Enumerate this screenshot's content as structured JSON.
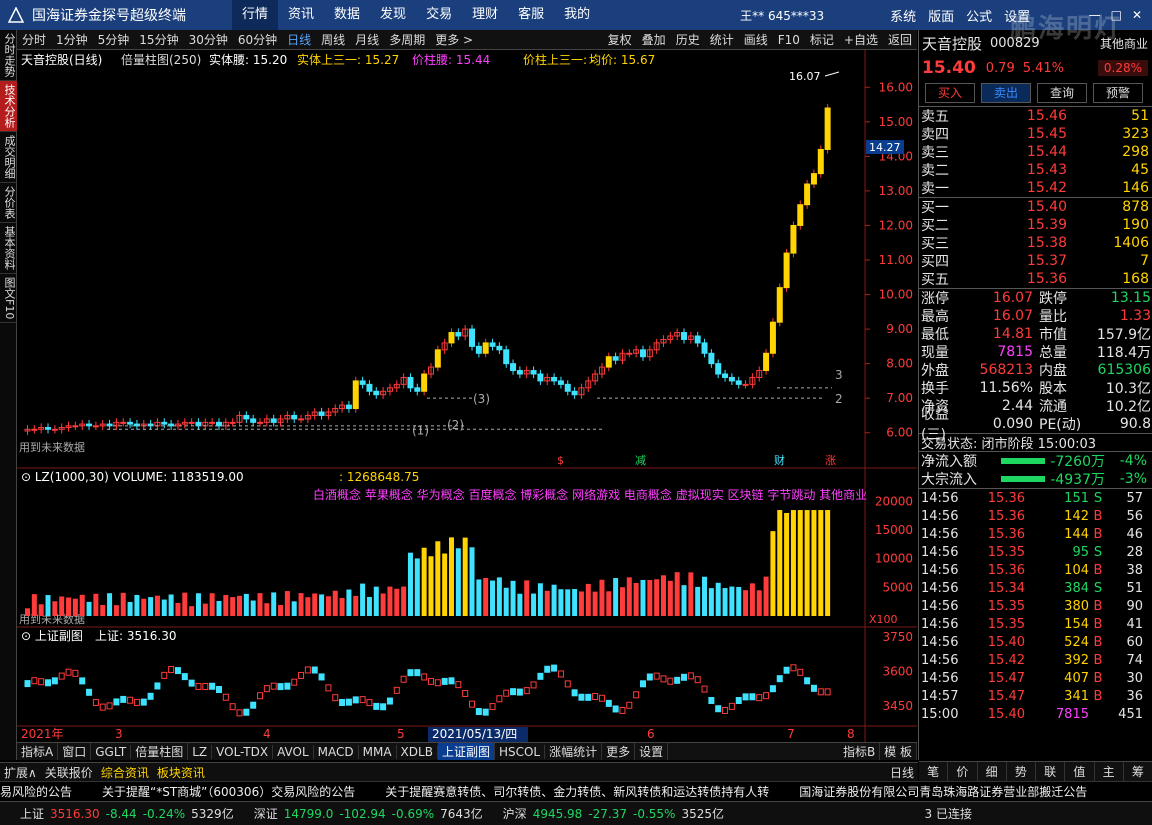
{
  "app": {
    "title": "国海证券金探号超级终端"
  },
  "menu": [
    "行情",
    "资讯",
    "数据",
    "发现",
    "交易",
    "理财",
    "客服",
    "我的"
  ],
  "user": "王**  645***33",
  "sys_menu": [
    "系统",
    "版面",
    "公式",
    "设置"
  ],
  "left_tabs": [
    "分时走势",
    "技术分析",
    "成交明细",
    "分价表",
    "基本资料",
    "图文F10"
  ],
  "toolbar": {
    "periods": [
      "分时",
      "1分钟",
      "5分钟",
      "15分钟",
      "30分钟",
      "60分钟",
      "日线",
      "周线",
      "月线",
      "多周期",
      "更多 >"
    ],
    "tools": [
      "复权",
      "叠加",
      "历史",
      "统计",
      "画线",
      "F10",
      "标记",
      "+自选",
      "返回"
    ]
  },
  "chart_data": {
    "type": "candlestick",
    "title": "天音控股(日线)",
    "indicator_line": {
      "label1": "倍量柱图(250)",
      "v1": "实体腰: 15.20",
      "v2": "实体上三一: 15.27",
      "v3": "价柱腰: 15.44",
      "v4": "价柱上三一: -",
      "v5": "均价: 15.67"
    },
    "y_ticks": [
      "16.00",
      "15.00",
      "14.00",
      "13.00",
      "12.00",
      "11.00",
      "10.00",
      "9.00",
      "8.00",
      "7.00",
      "6.00"
    ],
    "ylim": [
      5.5,
      16.5
    ],
    "marker_high": "16.07",
    "current_marker": "14.27",
    "closes": [
      6.1,
      6.1,
      6.15,
      6.1,
      6.1,
      6.15,
      6.2,
      6.2,
      6.25,
      6.2,
      6.2,
      6.25,
      6.2,
      6.3,
      6.3,
      6.25,
      6.2,
      6.25,
      6.2,
      6.3,
      6.25,
      6.2,
      6.25,
      6.3,
      6.3,
      6.2,
      6.3,
      6.3,
      6.2,
      6.3,
      6.3,
      6.5,
      6.4,
      6.3,
      6.3,
      6.4,
      6.3,
      6.4,
      6.5,
      6.4,
      6.4,
      6.5,
      6.6,
      6.5,
      6.6,
      6.7,
      6.8,
      6.7,
      7.5,
      7.4,
      7.2,
      7.1,
      7.2,
      7.3,
      7.4,
      7.6,
      7.3,
      7.2,
      7.7,
      7.9,
      8.4,
      8.6,
      8.9,
      8.8,
      9.0,
      8.5,
      8.3,
      8.6,
      8.5,
      8.4,
      8.0,
      7.8,
      7.7,
      7.8,
      7.7,
      7.5,
      7.6,
      7.5,
      7.4,
      7.2,
      7.1,
      7.3,
      7.5,
      7.7,
      7.9,
      8.2,
      8.1,
      8.3,
      8.3,
      8.4,
      8.2,
      8.4,
      8.6,
      8.7,
      8.8,
      8.9,
      8.7,
      8.8,
      8.6,
      8.3,
      8.0,
      7.7,
      7.6,
      7.5,
      7.4,
      7.4,
      7.6,
      7.8,
      8.3,
      9.2,
      10.2,
      11.2,
      12.0,
      12.6,
      13.2,
      13.5,
      14.2,
      15.4
    ],
    "sub_labels": {
      "left": "用到未来数据",
      "events": [
        "$",
        "减",
        "财",
        "涨"
      ]
    },
    "volume": {
      "label": "LZ(1000,30)",
      "value": "VOLUME: 1183519.00",
      "extra": ": 1268648.75",
      "y_ticks": [
        "20000",
        "15000",
        "10000",
        "5000"
      ],
      "scale": "X100",
      "concepts": "白酒概念 苹果概念 华为概念 百度概念 博彩概念 网络游戏 电商概念 虚拟现实 区块链 字节跳动  其他商业"
    },
    "index": {
      "label": "上证副图",
      "value": "上证: 3516.30",
      "y_ticks": [
        "3750",
        "3600",
        "3450"
      ]
    },
    "x_ticks": [
      "2021年",
      "3",
      "4",
      "5",
      "2021/05/13/四",
      "6",
      "7",
      "8"
    ]
  },
  "indicator_tabs": [
    "指标A",
    "窗口",
    "GGLT",
    "倍量柱图",
    "LZ",
    "VOL-TDX",
    "AVOL",
    "MACD",
    "MMA",
    "XDLB",
    "上证副图",
    "HSCOL",
    "涨幅统计",
    "更多",
    "设置"
  ],
  "right_tabs_lower": [
    "指标B",
    "模 板"
  ],
  "right": {
    "stock": {
      "name": "天音控股",
      "code": "000829",
      "sector": "其他商业",
      "price": "15.40",
      "change": "0.79",
      "pct": "5.41%",
      "badge": "0.28%"
    },
    "buttons": [
      "买入",
      "卖出",
      "查询",
      "预警"
    ],
    "asks": [
      {
        "label": "卖五",
        "price": "15.46",
        "vol": "51"
      },
      {
        "label": "卖四",
        "price": "15.45",
        "vol": "323"
      },
      {
        "label": "卖三",
        "price": "15.44",
        "vol": "298"
      },
      {
        "label": "卖二",
        "price": "15.43",
        "vol": "45"
      },
      {
        "label": "卖一",
        "price": "15.42",
        "vol": "146"
      }
    ],
    "bids": [
      {
        "label": "买一",
        "price": "15.40",
        "vol": "878"
      },
      {
        "label": "买二",
        "price": "15.39",
        "vol": "190"
      },
      {
        "label": "买三",
        "price": "15.38",
        "vol": "1406"
      },
      {
        "label": "买四",
        "price": "15.37",
        "vol": "7"
      },
      {
        "label": "买五",
        "price": "15.36",
        "vol": "168"
      }
    ],
    "stats": [
      {
        "k1": "涨停",
        "v1": "16.07",
        "k2": "跌停",
        "v2": "13.15"
      },
      {
        "k1": "最高",
        "v1": "16.07",
        "k2": "量比",
        "v2": "1.33"
      },
      {
        "k1": "最低",
        "v1": "14.81",
        "k2": "市值",
        "v2": "157.9亿"
      },
      {
        "k1": "现量",
        "v1": "7815",
        "k2": "总量",
        "v2": "118.4万"
      },
      {
        "k1": "外盘",
        "v1": "568213",
        "k2": "内盘",
        "v2": "615306"
      },
      {
        "k1": "换手",
        "v1": "11.56%",
        "k2": "股本",
        "v2": "10.3亿"
      },
      {
        "k1": "净资",
        "v1": "2.44",
        "k2": "流通",
        "v2": "10.2亿"
      },
      {
        "k1": "收益(三)",
        "v1": "0.090",
        "k2": "PE(动)",
        "v2": "90.8"
      }
    ],
    "trade_state": "交易状态: 闭市阶段 15:00:03",
    "flows": [
      {
        "k": "净流入额",
        "v": "-7260万",
        "p": "-4%"
      },
      {
        "k": "大宗流入",
        "v": "-4937万",
        "p": "-3%"
      }
    ],
    "ticks": [
      {
        "t": "14:56",
        "p": "15.36",
        "v": "151",
        "d": "S",
        "n": "57"
      },
      {
        "t": "14:56",
        "p": "15.36",
        "v": "142",
        "d": "B",
        "n": "56"
      },
      {
        "t": "14:56",
        "p": "15.36",
        "v": "144",
        "d": "B",
        "n": "46"
      },
      {
        "t": "14:56",
        "p": "15.35",
        "v": "95",
        "d": "S",
        "n": "28"
      },
      {
        "t": "14:56",
        "p": "15.36",
        "v": "104",
        "d": "B",
        "n": "38"
      },
      {
        "t": "14:56",
        "p": "15.34",
        "v": "384",
        "d": "S",
        "n": "51"
      },
      {
        "t": "14:56",
        "p": "15.35",
        "v": "380",
        "d": "B",
        "n": "90"
      },
      {
        "t": "14:56",
        "p": "15.35",
        "v": "154",
        "d": "B",
        "n": "41"
      },
      {
        "t": "14:56",
        "p": "15.40",
        "v": "524",
        "d": "B",
        "n": "60"
      },
      {
        "t": "14:56",
        "p": "15.42",
        "v": "392",
        "d": "B",
        "n": "74"
      },
      {
        "t": "14:56",
        "p": "15.47",
        "v": "407",
        "d": "B",
        "n": "30"
      },
      {
        "t": "14:57",
        "p": "15.47",
        "v": "341",
        "d": "B",
        "n": "36"
      },
      {
        "t": "15:00",
        "p": "15.40",
        "v": "7815",
        "d": "",
        "n": "451"
      }
    ],
    "tabs": [
      "笔",
      "价",
      "细",
      "势",
      "联",
      "值",
      "主",
      "筹"
    ]
  },
  "bottom_tabs": [
    "扩展∧",
    "关联报价",
    "综合资讯",
    "板块资讯",
    "日线"
  ],
  "news": [
    "易风险的公告",
    "关于提醒“*ST商城”（600306）交易风险的公告",
    "关于提醒赛意转债、司尔转债、金力转债、新风转债和运达转债持有人转",
    "国海证券股份有限公司青岛珠海路证券营业部搬迁公告"
  ],
  "index_bar": {
    "sh": "上证",
    "sh_v": "3516.30",
    "sh_c": "-8.44",
    "sh_p": "-0.24%",
    "sh_a": "5329亿",
    "sz": "深证",
    "sz_v": "14799.0",
    "sz_c": "-102.94",
    "sz_p": "-0.69%",
    "sz_a": "7643亿",
    "hs": "沪深",
    "hs_v": "4945.98",
    "hs_c": "-27.37",
    "hs_p": "-0.55%",
    "hs_a": "3525亿",
    "conn": "3 已连接"
  },
  "watermark": "鹏海明灯"
}
